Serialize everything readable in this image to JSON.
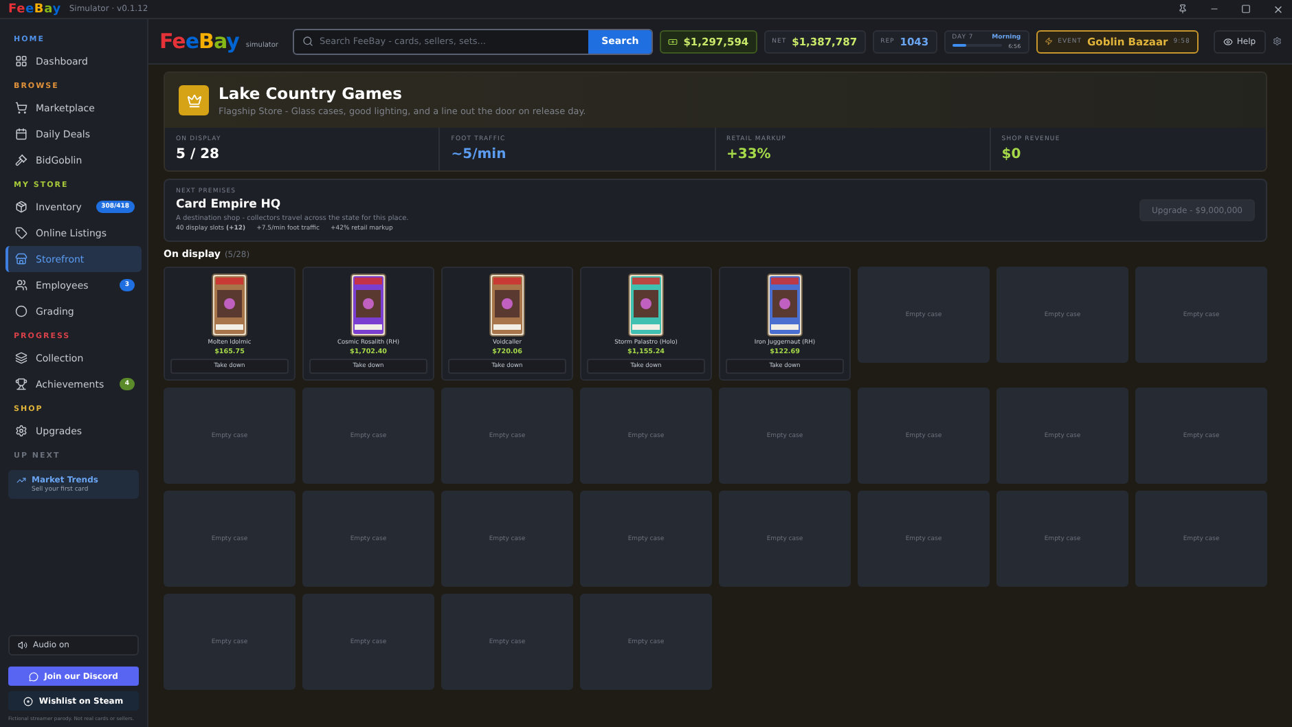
{
  "titlebar": {
    "logo": "FeeBay",
    "subtitle": "Simulator · v0.1.12"
  },
  "sidebar": {
    "sections": [
      {
        "label": "HOME",
        "color": "#4f8fe6",
        "items": [
          {
            "label": "Dashboard",
            "selected": false
          }
        ]
      },
      {
        "label": "BROWSE",
        "color": "#e0913a",
        "items": [
          {
            "label": "Marketplace",
            "selected": false
          },
          {
            "label": "Daily Deals",
            "selected": false
          },
          {
            "label": "BidGoblin",
            "selected": false
          }
        ]
      },
      {
        "label": "MY STORE",
        "color": "#a6c83a",
        "items": [
          {
            "label": "Inventory",
            "selected": false,
            "badge": "308/418",
            "color": "#1f6fe0"
          },
          {
            "label": "Online Listings",
            "selected": false
          },
          {
            "label": "Storefront",
            "selected": true
          },
          {
            "label": "Employees",
            "selected": false,
            "badge": "3",
            "color": "#1f6fe0"
          },
          {
            "label": "Grading",
            "selected": false
          }
        ]
      },
      {
        "label": "PROGRESS",
        "color": "#d9414a",
        "items": [
          {
            "label": "Collection",
            "selected": false
          },
          {
            "label": "Achievements",
            "selected": false,
            "badge": "4",
            "color": "#5a8a2a"
          }
        ]
      },
      {
        "label": "SHOP",
        "color": "#e0b43a",
        "items": [
          {
            "label": "Upgrades",
            "selected": false
          }
        ]
      }
    ],
    "up_next": {
      "label": "UP NEXT",
      "title": "Market Trends",
      "subtitle": "Sell your first card"
    },
    "audio": "Audio on",
    "discord": "Join our Discord",
    "steam": "Wishlist on Steam",
    "footer": "Fictional streamer parody. Not real cards or sellers."
  },
  "header": {
    "logo": "FeeBay",
    "logo_sub": "simulator",
    "search": {
      "placeholder": "Search FeeBay - cards, sellers, sets..."
    },
    "search_button": "Search",
    "cash": "$1,297,594",
    "net_label": "NET",
    "net": "$1,387,787",
    "rep_label": "REP",
    "rep": "1043",
    "day": {
      "label": "DAY 7",
      "phase": "Morning",
      "time": "6:56",
      "level": 0.3
    },
    "event": {
      "label": "EVENT",
      "name": "Goblin Bazaar",
      "time": "9:58"
    },
    "help": "Help"
  },
  "store": {
    "name": "Lake Country Games",
    "tagline": "Flagship Store - Glass cases, good lighting, and a line out the door on release day.",
    "stats": [
      {
        "label": "ON DISPLAY",
        "value": "5 / 28",
        "color": "#ffffff"
      },
      {
        "label": "FOOT TRAFFIC",
        "value": "~5/min",
        "color": "#5b9cf0"
      },
      {
        "label": "RETAIL MARKUP",
        "value": "+33%",
        "color": "#a6d94a"
      },
      {
        "label": "SHOP REVENUE",
        "value": "$0",
        "color": "#a6d94a"
      }
    ]
  },
  "next_premises": {
    "label": "NEXT PREMISES",
    "name": "Card Empire HQ",
    "description": "A destination shop - collectors travel across the state for this place.",
    "perks": [
      "40 display slots **(+12)**",
      "+7.5/min foot traffic",
      "+42% retail markup"
    ],
    "upgrade_button": "Upgrade - $9,000,000",
    "upgrade_disabled": true
  },
  "display": {
    "title": "On display",
    "count": "(5/28)",
    "cases": [
      {
        "kind": "card",
        "name": "Molten Idolmic",
        "price": "$165.75",
        "color": "#a8744a",
        "button": "Take down"
      },
      {
        "kind": "card",
        "name": "Cosmic Rosalith (RH)",
        "price": "$1,702.40",
        "color": "#7a3fd0",
        "button": "Take down"
      },
      {
        "kind": "card",
        "name": "Voidcaller",
        "price": "$720.06",
        "color": "#a8744a",
        "button": "Take down"
      },
      {
        "kind": "card",
        "name": "Storm Palastro (Holo)",
        "price": "$1,155.24",
        "color": "#3fc0b0",
        "button": "Take down"
      },
      {
        "kind": "card",
        "name": "Iron Juggernaut (RH)",
        "price": "$122.69",
        "color": "#4a6fd0",
        "button": "Take down"
      },
      {
        "kind": "empty",
        "label": "Empty case"
      },
      {
        "kind": "empty",
        "label": "Empty case"
      },
      {
        "kind": "empty",
        "label": "Empty case"
      },
      {
        "kind": "empty",
        "label": "Empty case"
      },
      {
        "kind": "empty",
        "label": "Empty case"
      },
      {
        "kind": "empty",
        "label": "Empty case"
      },
      {
        "kind": "empty",
        "label": "Empty case"
      },
      {
        "kind": "empty",
        "label": "Empty case"
      },
      {
        "kind": "empty",
        "label": "Empty case"
      },
      {
        "kind": "empty",
        "label": "Empty case"
      },
      {
        "kind": "empty",
        "label": "Empty case"
      },
      {
        "kind": "empty",
        "label": "Empty case"
      },
      {
        "kind": "empty",
        "label": "Empty case"
      },
      {
        "kind": "empty",
        "label": "Empty case"
      },
      {
        "kind": "empty",
        "label": "Empty case"
      },
      {
        "kind": "empty",
        "label": "Empty case"
      },
      {
        "kind": "empty",
        "label": "Empty case"
      },
      {
        "kind": "empty",
        "label": "Empty case"
      },
      {
        "kind": "empty",
        "label": "Empty case"
      },
      {
        "kind": "empty",
        "label": "Empty case"
      },
      {
        "kind": "empty",
        "label": "Empty case"
      },
      {
        "kind": "empty",
        "label": "Empty case"
      },
      {
        "kind": "empty",
        "label": "Empty case"
      }
    ]
  }
}
